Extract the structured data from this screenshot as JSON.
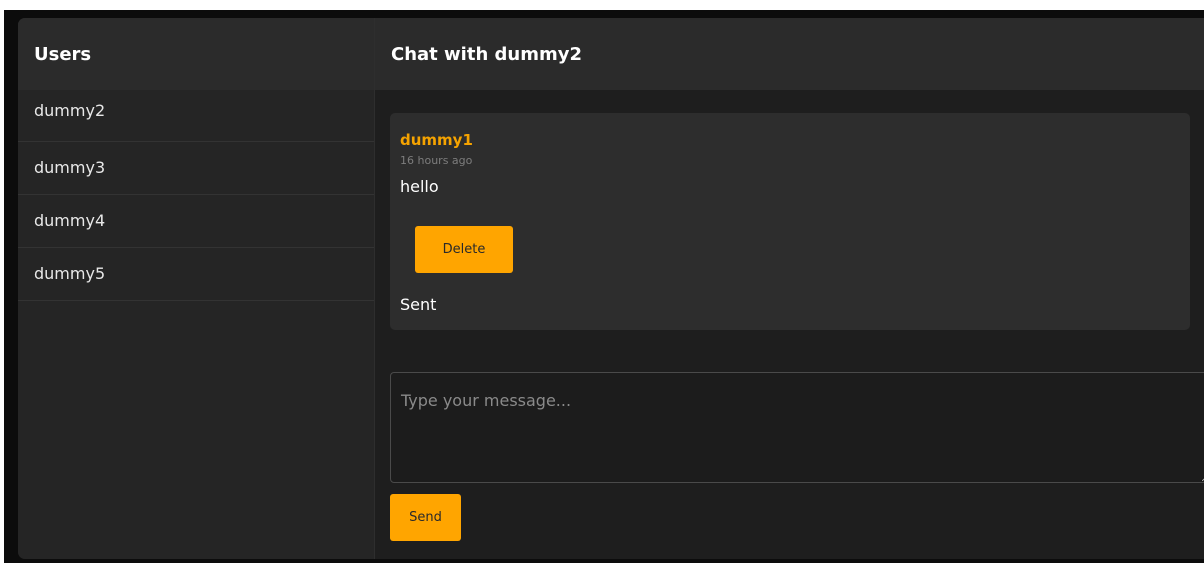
{
  "sidebar": {
    "title": "Users",
    "users": [
      {
        "name": "dummy2"
      },
      {
        "name": "dummy3"
      },
      {
        "name": "dummy4"
      },
      {
        "name": "dummy5"
      }
    ]
  },
  "chat": {
    "title": "Chat with dummy2",
    "messages": [
      {
        "author": "dummy1",
        "time": "16 hours ago",
        "text": "hello",
        "delete_label": "Delete",
        "status": "Sent"
      }
    ],
    "input": {
      "placeholder": "Type your message...",
      "value": ""
    },
    "send_label": "Send"
  },
  "colors": {
    "accent": "#ffa500",
    "author": "#f5a300",
    "background": "#1e1e1e",
    "sidebar": "#252525",
    "header": "#2b2b2b",
    "card": "#2d2d2d"
  }
}
